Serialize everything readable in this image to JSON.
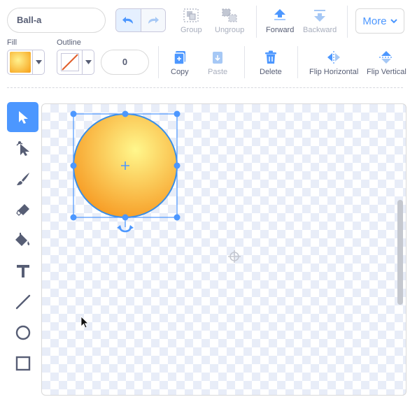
{
  "costume": {
    "name": "Ball-a"
  },
  "toolbar": {
    "group_label": "Group",
    "ungroup_label": "Ungroup",
    "forward_label": "Forward",
    "backward_label": "Backward",
    "more_label": "More",
    "copy_label": "Copy",
    "paste_label": "Paste",
    "delete_label": "Delete",
    "flip_horizontal_label": "Flip Horizontal",
    "flip_vertical_label": "Flip Vertical"
  },
  "style": {
    "fill_label": "Fill",
    "outline_label": "Outline",
    "outline_width": "0",
    "fill_color_start": "#ffef8a",
    "fill_color_end": "#f7a21b",
    "accent": "#4c97ff"
  },
  "tools": [
    "select-icon",
    "reshape-icon",
    "brush-icon",
    "eraser-icon",
    "fill-icon",
    "text-icon",
    "line-icon",
    "circle-icon",
    "rectangle-icon"
  ],
  "selected_tool": "select-icon"
}
